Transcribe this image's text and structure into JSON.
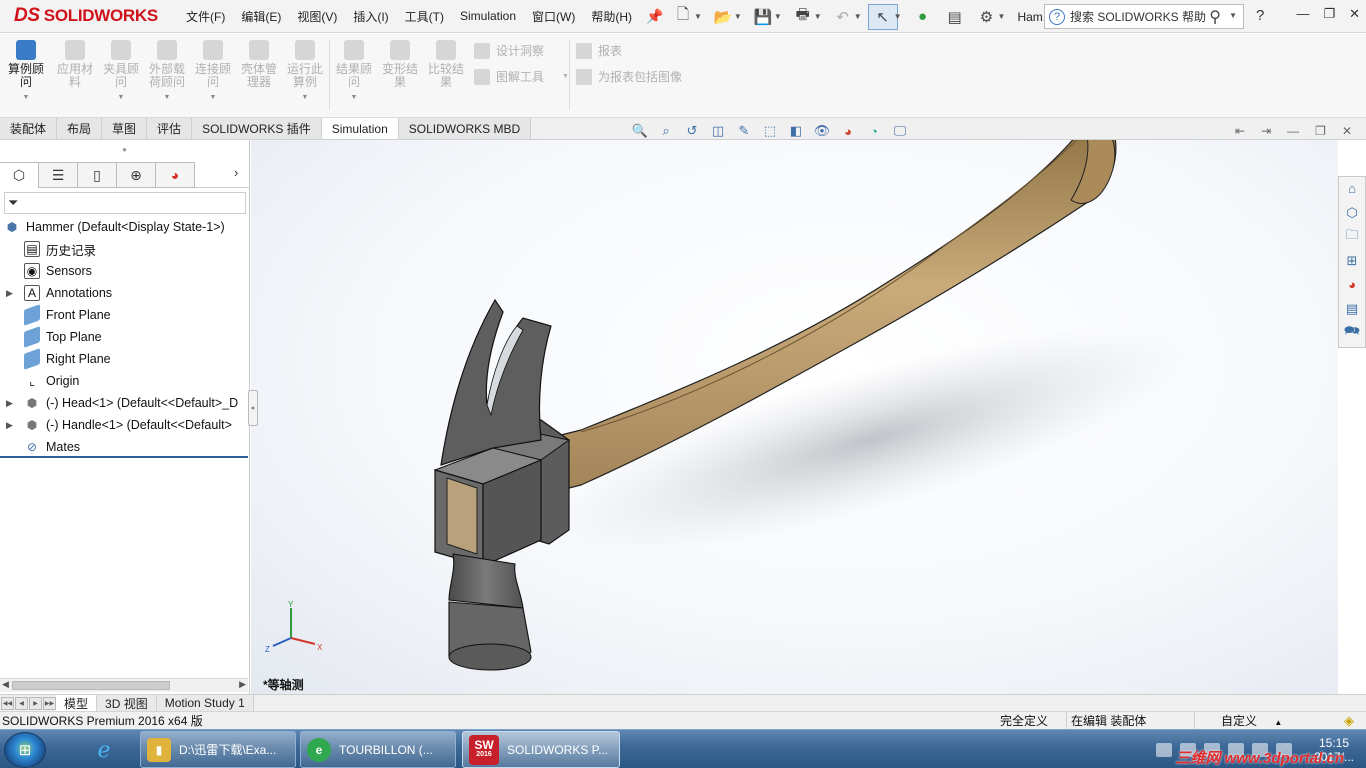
{
  "app": {
    "brand": "SOLIDWORKS",
    "brand_prefix": "DS"
  },
  "menu": [
    "文件(F)",
    "编辑(E)",
    "视图(V)",
    "插入(I)",
    "工具(T)",
    "Simulation",
    "窗口(W)",
    "帮助(H)"
  ],
  "quick_access": {
    "doc_name": "Ham...",
    "search_placeholder": "搜索 SOLIDWORKS 帮助",
    "help": "?"
  },
  "ribbon": {
    "buttons": [
      {
        "label": "算例顾问",
        "enabled": true
      },
      {
        "label": "应用材料",
        "enabled": false
      },
      {
        "label": "夹具顾问",
        "enabled": false
      },
      {
        "label": "外部载荷顾问",
        "enabled": false
      },
      {
        "label": "连接顾问",
        "enabled": false
      },
      {
        "label": "壳体管理器",
        "enabled": false
      },
      {
        "label": "运行此算例",
        "enabled": false
      },
      {
        "label": "结果顾问",
        "enabled": false
      },
      {
        "label": "变形结果",
        "enabled": false
      },
      {
        "label": "比较结果",
        "enabled": false
      }
    ],
    "small_left": [
      "设计洞察",
      "图解工具"
    ],
    "small_right": [
      "报表",
      "为报表包括图像"
    ]
  },
  "tabs": [
    "装配体",
    "布局",
    "草图",
    "评估",
    "SOLIDWORKS 插件",
    "Simulation",
    "SOLIDWORKS MBD"
  ],
  "active_tab": "Simulation",
  "feature_tree": [
    {
      "label": "Hammer  (Default<Display State-1>)",
      "icon": "assembly-icon",
      "expandable": false,
      "indent": 0
    },
    {
      "label": "历史记录",
      "icon": "history-icon",
      "expandable": false,
      "indent": 1
    },
    {
      "label": "Sensors",
      "icon": "sensor-icon",
      "expandable": false,
      "indent": 1
    },
    {
      "label": "Annotations",
      "icon": "annotations-icon",
      "expandable": true,
      "indent": 1
    },
    {
      "label": "Front Plane",
      "icon": "plane-icon",
      "expandable": false,
      "indent": 1
    },
    {
      "label": "Top Plane",
      "icon": "plane-icon",
      "expandable": false,
      "indent": 1
    },
    {
      "label": "Right Plane",
      "icon": "plane-icon",
      "expandable": false,
      "indent": 1
    },
    {
      "label": "Origin",
      "icon": "origin-icon",
      "expandable": false,
      "indent": 1
    },
    {
      "label": "(-) Head<1> (Default<<Default>_D",
      "icon": "part-icon",
      "expandable": true,
      "indent": 1
    },
    {
      "label": "(-) Handle<1> (Default<<Default>",
      "icon": "part-icon",
      "expandable": true,
      "indent": 1
    },
    {
      "label": "Mates",
      "icon": "mates-icon",
      "expandable": false,
      "indent": 1
    }
  ],
  "viewport": {
    "view_name": "*等轴测",
    "triad": {
      "x": "X",
      "y": "Y",
      "z": "Z"
    }
  },
  "bottom_tabs": [
    "模型",
    "3D 视图",
    "Motion Study 1"
  ],
  "active_bottom_tab": "模型",
  "status": {
    "product": "SOLIDWORKS Premium 2016 x64 版",
    "def": "完全定义",
    "mode": "在编辑 装配体",
    "units": "自定义"
  },
  "taskbar": {
    "tasks": [
      {
        "label": "D:\\迅雷下载\\Exa...",
        "icon": "folder-icon",
        "color": "#e0b43c"
      },
      {
        "label": "TOURBILLON (...",
        "icon": "browser-icon",
        "color": "#2fa84f"
      },
      {
        "label": "SOLIDWORKS P...",
        "icon": "solidworks-icon",
        "color": "#c8202a",
        "badge": "2016"
      }
    ],
    "clock_time": "15:15",
    "clock_date": "2017/...",
    "watermark": "三维网 www.3dportal.cn"
  },
  "colors": {
    "accent": "#3b7cc9",
    "brand": "#d0121b",
    "wood": "#a58a5c",
    "steel": "#6e6e6e"
  }
}
